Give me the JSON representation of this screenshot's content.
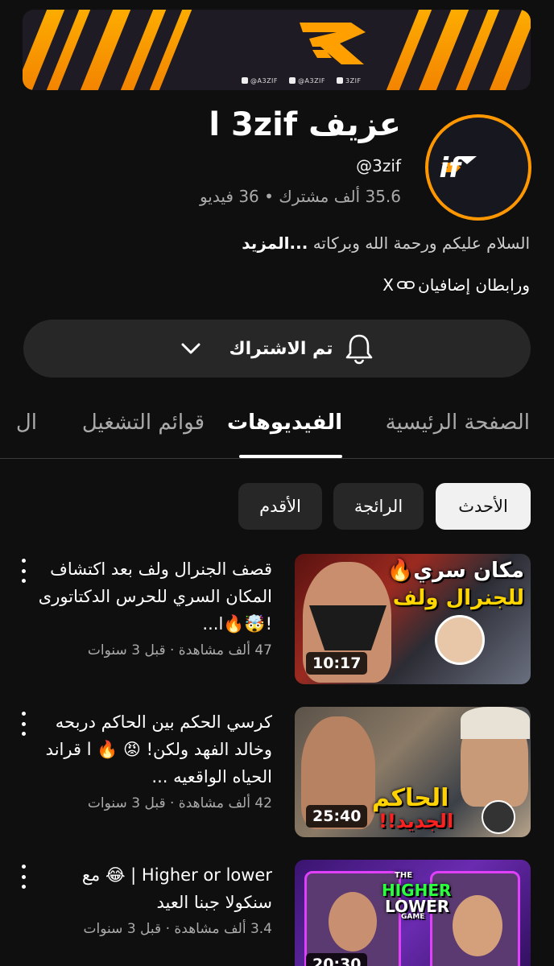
{
  "banner": {
    "socials": [
      "@A3ZIF",
      "@A3ZIF",
      "3ZIF"
    ]
  },
  "channel": {
    "name": "عزيف l 3zif",
    "handle": "@3zif",
    "stats": "35.6 ألف مشترك • 36 فيديو",
    "description": "السلام عليكم ورحمة الله وبركاته",
    "more_label": "...المزيد",
    "links_prefix": "X",
    "links_label": "ورابطان إضافيان"
  },
  "subscribe": {
    "label": "تم الاشتراك"
  },
  "tabs": [
    {
      "label": "الصفحة الرئيسية"
    },
    {
      "label": "الفيديوهات"
    },
    {
      "label": "قوائم التشغيل"
    },
    {
      "label": "ال"
    }
  ],
  "chips": [
    {
      "label": "الأحدث"
    },
    {
      "label": "الرائجة"
    },
    {
      "label": "الأقدم"
    }
  ],
  "videos": [
    {
      "title": "قصف الجنرال ولف بعد اكتشاف المكان السري للحرس الدكتاتورى !🤯🔥ا...",
      "meta": "47 ألف مشاهدة · قبل 3 سنوات",
      "duration": "10:17",
      "thumb_text_1": "مكان سري🔥",
      "thumb_text_2": "للجنرال ولف"
    },
    {
      "title": "كرسي الحكم بين الحاكم دربحه وخالد الفهد ولكن! 😡 🔥 l قراند الحياه الواقعيه ...",
      "meta": "42 ألف مشاهدة · قبل 3 سنوات",
      "duration": "25:40",
      "thumb_text_1": "الحاكم",
      "thumb_text_2": "الجديد!!"
    },
    {
      "title": "Higher or lower | 😂 مع سنكولا جبنا العيد",
      "meta": "3.4 ألف مشاهدة · قبل 3 سنوات",
      "duration": "20:30",
      "thumb_text_1": "HIGHER",
      "thumb_text_2": "LOWER",
      "thumb_text_3": "THE",
      "thumb_text_4": "GAME"
    }
  ],
  "colors": {
    "background": "#0f0f0f",
    "accent": "#ff9800",
    "chip_active": "#f1f1f1",
    "chip": "#272727"
  }
}
